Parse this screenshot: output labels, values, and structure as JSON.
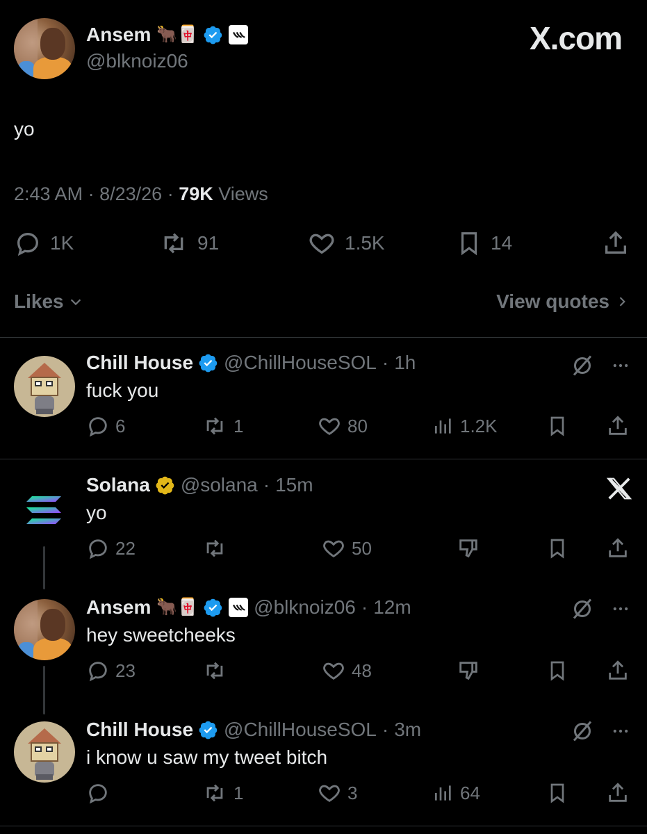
{
  "watermark": "X.com",
  "main_tweet": {
    "author_name": "Ansem",
    "author_emojis": "🐂🀄",
    "handle": "@blknoiz06",
    "text": "yo",
    "time": "2:43 AM",
    "date": "8/23/26",
    "views_count": "79K",
    "views_label": "Views",
    "replies": "1K",
    "reposts": "91",
    "likes": "1.5K",
    "bookmarks": "14",
    "likes_label": "Likes",
    "view_quotes_label": "View quotes"
  },
  "replies": [
    {
      "name": "Chill House",
      "handle": "@ChillHouseSOL",
      "time": "1h",
      "text": "fuck you",
      "replies": "6",
      "reposts": "1",
      "likes": "80",
      "views": "1.2K"
    },
    {
      "name": "Solana",
      "handle": "@solana",
      "time": "15m",
      "text": "yo",
      "replies": "22",
      "reposts": "",
      "likes": "50"
    },
    {
      "name": "Ansem",
      "emojis": "🐂🀄",
      "handle": "@blknoiz06",
      "time": "12m",
      "text": "hey sweetcheeks",
      "replies": "23",
      "reposts": "",
      "likes": "48"
    },
    {
      "name": "Chill House",
      "handle": "@ChillHouseSOL",
      "time": "3m",
      "text": "i know u saw my tweet bitch",
      "replies": "",
      "reposts": "1",
      "likes": "3",
      "views": "64"
    }
  ],
  "separator": "·",
  "colors": {
    "verified_blue": "#1d9bf0",
    "verified_gold": "#e2b719",
    "muted": "#71767b",
    "text": "#e7e9ea"
  }
}
